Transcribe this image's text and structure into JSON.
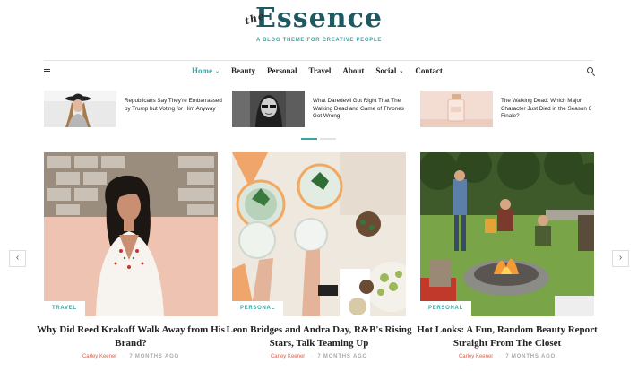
{
  "brand": {
    "logo_prefix": "the",
    "logo_text": "Essence",
    "tagline": "A BLOG THEME FOR CREATIVE PEOPLE"
  },
  "nav": {
    "items": [
      {
        "label": "Home",
        "has_dropdown": true,
        "active": true
      },
      {
        "label": "Beauty"
      },
      {
        "label": "Personal"
      },
      {
        "label": "Travel"
      },
      {
        "label": "About"
      },
      {
        "label": "Social",
        "has_dropdown": true
      },
      {
        "label": "Contact"
      }
    ],
    "caret": "⌄"
  },
  "trending": [
    {
      "title": "Republicans Say They're Embarrassed by Trump but Voting for Him Anyway"
    },
    {
      "title": "What Daredevil Got Right That The Walking Dead and Game of Thrones Got Wrong"
    },
    {
      "title": "The Walking Dead: Which Major Character Just Died in the Season 6 Finale?"
    }
  ],
  "arrows": {
    "prev": "‹",
    "next": "›"
  },
  "cards": [
    {
      "category": "TRAVEL",
      "title": "Why Did Reed Krakoff Walk Away from His Brand?",
      "author": "Carley Keener",
      "date": "7 MONTHS AGO"
    },
    {
      "category": "PERSONAL",
      "title": "Leon Bridges and Andra Day, R&B's Rising Stars, Talk Teaming Up",
      "author": "Carley Keener",
      "date": "7 MONTHS AGO"
    },
    {
      "category": "PERSONAL",
      "title": "Hot Looks: A Fun, Random Beauty Report Straight From The Closet",
      "author": "Carley Keener",
      "date": "7 MONTHS AGO"
    }
  ],
  "meta_separator": "·",
  "colors": {
    "accent": "#3aa6a3",
    "author": "#e2604a",
    "logo": "#1f5a63"
  }
}
